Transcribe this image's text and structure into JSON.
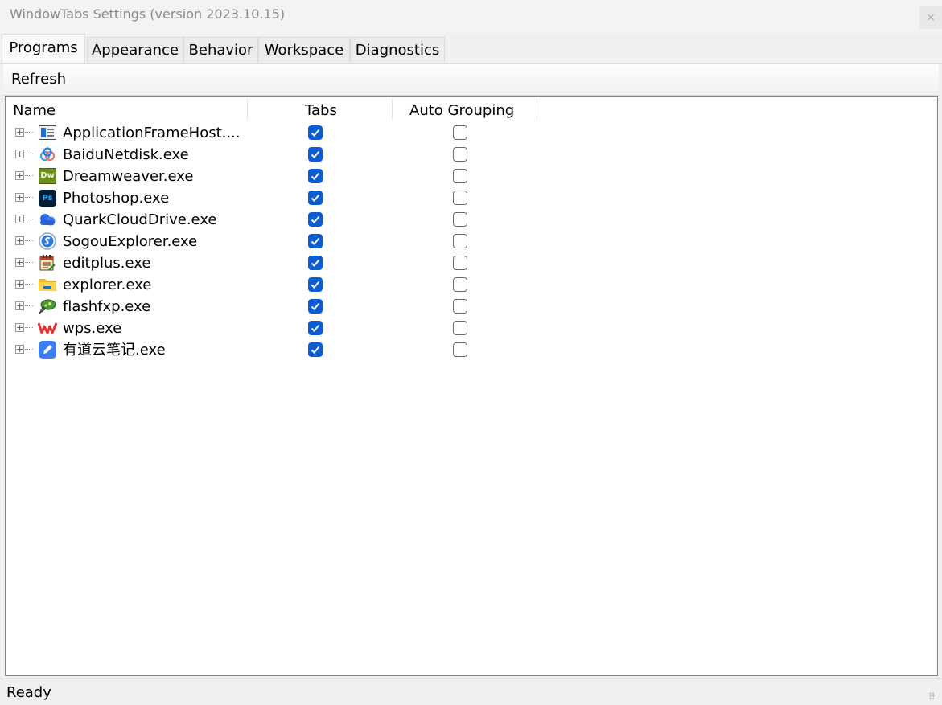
{
  "window": {
    "title": "WindowTabs Settings (version 2023.10.15)",
    "close_glyph": "×"
  },
  "tabs": [
    {
      "label": "Programs",
      "active": true
    },
    {
      "label": "Appearance",
      "active": false
    },
    {
      "label": "Behavior",
      "active": false
    },
    {
      "label": "Workspace",
      "active": false
    },
    {
      "label": "Diagnostics",
      "active": false
    }
  ],
  "toolbar": {
    "refresh_label": "Refresh"
  },
  "columns": {
    "name": "Name",
    "tabs": "Tabs",
    "auto_grouping": "Auto Grouping"
  },
  "programs": [
    {
      "name": "ApplicationFrameHost....",
      "icon": "app-frame-icon",
      "tabs": true,
      "auto_grouping": false
    },
    {
      "name": "BaiduNetdisk.exe",
      "icon": "baidu-netdisk-icon",
      "tabs": true,
      "auto_grouping": false
    },
    {
      "name": "Dreamweaver.exe",
      "icon": "dreamweaver-icon",
      "icon_text": "Dw",
      "tabs": true,
      "auto_grouping": false
    },
    {
      "name": "Photoshop.exe",
      "icon": "photoshop-icon",
      "icon_text": "Ps",
      "tabs": true,
      "auto_grouping": false
    },
    {
      "name": "QuarkCloudDrive.exe",
      "icon": "quark-cloud-icon",
      "tabs": true,
      "auto_grouping": false
    },
    {
      "name": "SogouExplorer.exe",
      "icon": "sogou-explorer-icon",
      "tabs": true,
      "auto_grouping": false
    },
    {
      "name": "editplus.exe",
      "icon": "editplus-icon",
      "tabs": true,
      "auto_grouping": false
    },
    {
      "name": "explorer.exe",
      "icon": "folder-icon",
      "tabs": true,
      "auto_grouping": false
    },
    {
      "name": "flashfxp.exe",
      "icon": "flashfxp-icon",
      "tabs": true,
      "auto_grouping": false
    },
    {
      "name": "wps.exe",
      "icon": "wps-icon",
      "tabs": true,
      "auto_grouping": false
    },
    {
      "name": "有道云笔记.exe",
      "icon": "youdao-note-icon",
      "tabs": true,
      "auto_grouping": false
    }
  ],
  "status": {
    "text": "Ready",
    "grip": "⠿"
  },
  "colors": {
    "checkbox_checked": "#0b5cd5",
    "list_background": "#ffffff",
    "window_background": "#f0f0f0"
  }
}
